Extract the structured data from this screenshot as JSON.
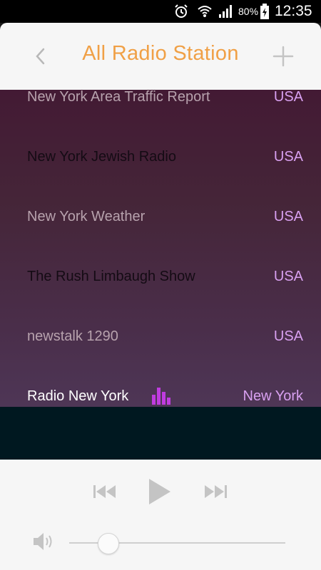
{
  "status_bar": {
    "battery_percent": "80%",
    "time": "12:35"
  },
  "header": {
    "title": "All Radio Station"
  },
  "stations": [
    {
      "name": "New York Area Traffic Report",
      "country": "USA"
    },
    {
      "name": "New York Jewish Radio",
      "country": "USA"
    },
    {
      "name": "New York Weather",
      "country": "USA"
    },
    {
      "name": "The Rush Limbaugh Show",
      "country": "USA"
    },
    {
      "name": "newstalk 1290",
      "country": "USA"
    },
    {
      "name": "Radio New York",
      "country": "New York",
      "playing": true
    }
  ],
  "player": {
    "volume_level": 0.18
  },
  "colors": {
    "accent_title": "#f0a046",
    "country_text": "#d8a0f0",
    "playing_indicator": "#c03ce0"
  }
}
